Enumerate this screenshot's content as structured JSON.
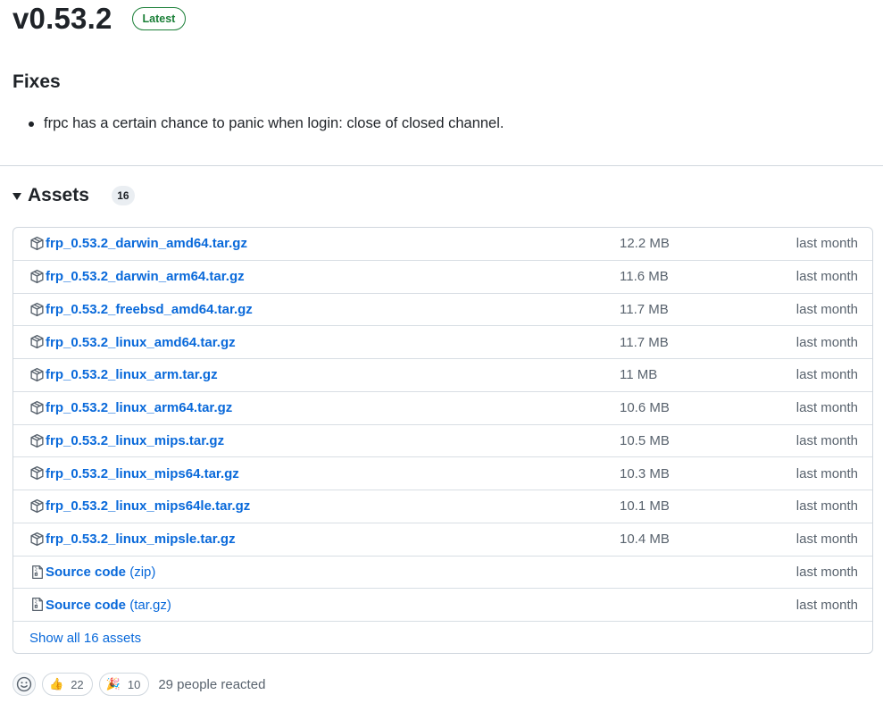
{
  "release": {
    "version": "v0.53.2",
    "badge": "Latest"
  },
  "notes": {
    "heading": "Fixes",
    "items": [
      "frpc has a certain chance to panic when login: close of closed channel."
    ]
  },
  "assets": {
    "title": "Assets",
    "count": "16",
    "files": [
      {
        "name": "frp_0.53.2_darwin_amd64.tar.gz",
        "size": "12.2 MB",
        "date": "last month",
        "icon": "package-icon"
      },
      {
        "name": "frp_0.53.2_darwin_arm64.tar.gz",
        "size": "11.6 MB",
        "date": "last month",
        "icon": "package-icon"
      },
      {
        "name": "frp_0.53.2_freebsd_amd64.tar.gz",
        "size": "11.7 MB",
        "date": "last month",
        "icon": "package-icon"
      },
      {
        "name": "frp_0.53.2_linux_amd64.tar.gz",
        "size": "11.7 MB",
        "date": "last month",
        "icon": "package-icon"
      },
      {
        "name": "frp_0.53.2_linux_arm.tar.gz",
        "size": "11 MB",
        "date": "last month",
        "icon": "package-icon"
      },
      {
        "name": "frp_0.53.2_linux_arm64.tar.gz",
        "size": "10.6 MB",
        "date": "last month",
        "icon": "package-icon"
      },
      {
        "name": "frp_0.53.2_linux_mips.tar.gz",
        "size": "10.5 MB",
        "date": "last month",
        "icon": "package-icon"
      },
      {
        "name": "frp_0.53.2_linux_mips64.tar.gz",
        "size": "10.3 MB",
        "date": "last month",
        "icon": "package-icon"
      },
      {
        "name": "frp_0.53.2_linux_mips64le.tar.gz",
        "size": "10.1 MB",
        "date": "last month",
        "icon": "package-icon"
      },
      {
        "name": "frp_0.53.2_linux_mipsle.tar.gz",
        "size": "10.4 MB",
        "date": "last month",
        "icon": "package-icon"
      }
    ],
    "source": [
      {
        "name": "Source code",
        "suffix": "(zip)",
        "date": "last month",
        "icon": "file-zip-icon"
      },
      {
        "name": "Source code",
        "suffix": "(tar.gz)",
        "date": "last month",
        "icon": "file-zip-icon"
      }
    ],
    "show_all": "Show all 16 assets"
  },
  "reactions": {
    "add_icon": "smiley-icon",
    "items": [
      {
        "emoji": "👍",
        "count": "22",
        "icon": "thumbs-up-icon"
      },
      {
        "emoji": "🎉",
        "count": "10",
        "icon": "tada-icon"
      }
    ],
    "summary": "29 people reacted"
  },
  "colors": {
    "link": "#0969da",
    "latest": "#1a7f37",
    "muted": "#59636e",
    "border": "#d0d7de"
  }
}
